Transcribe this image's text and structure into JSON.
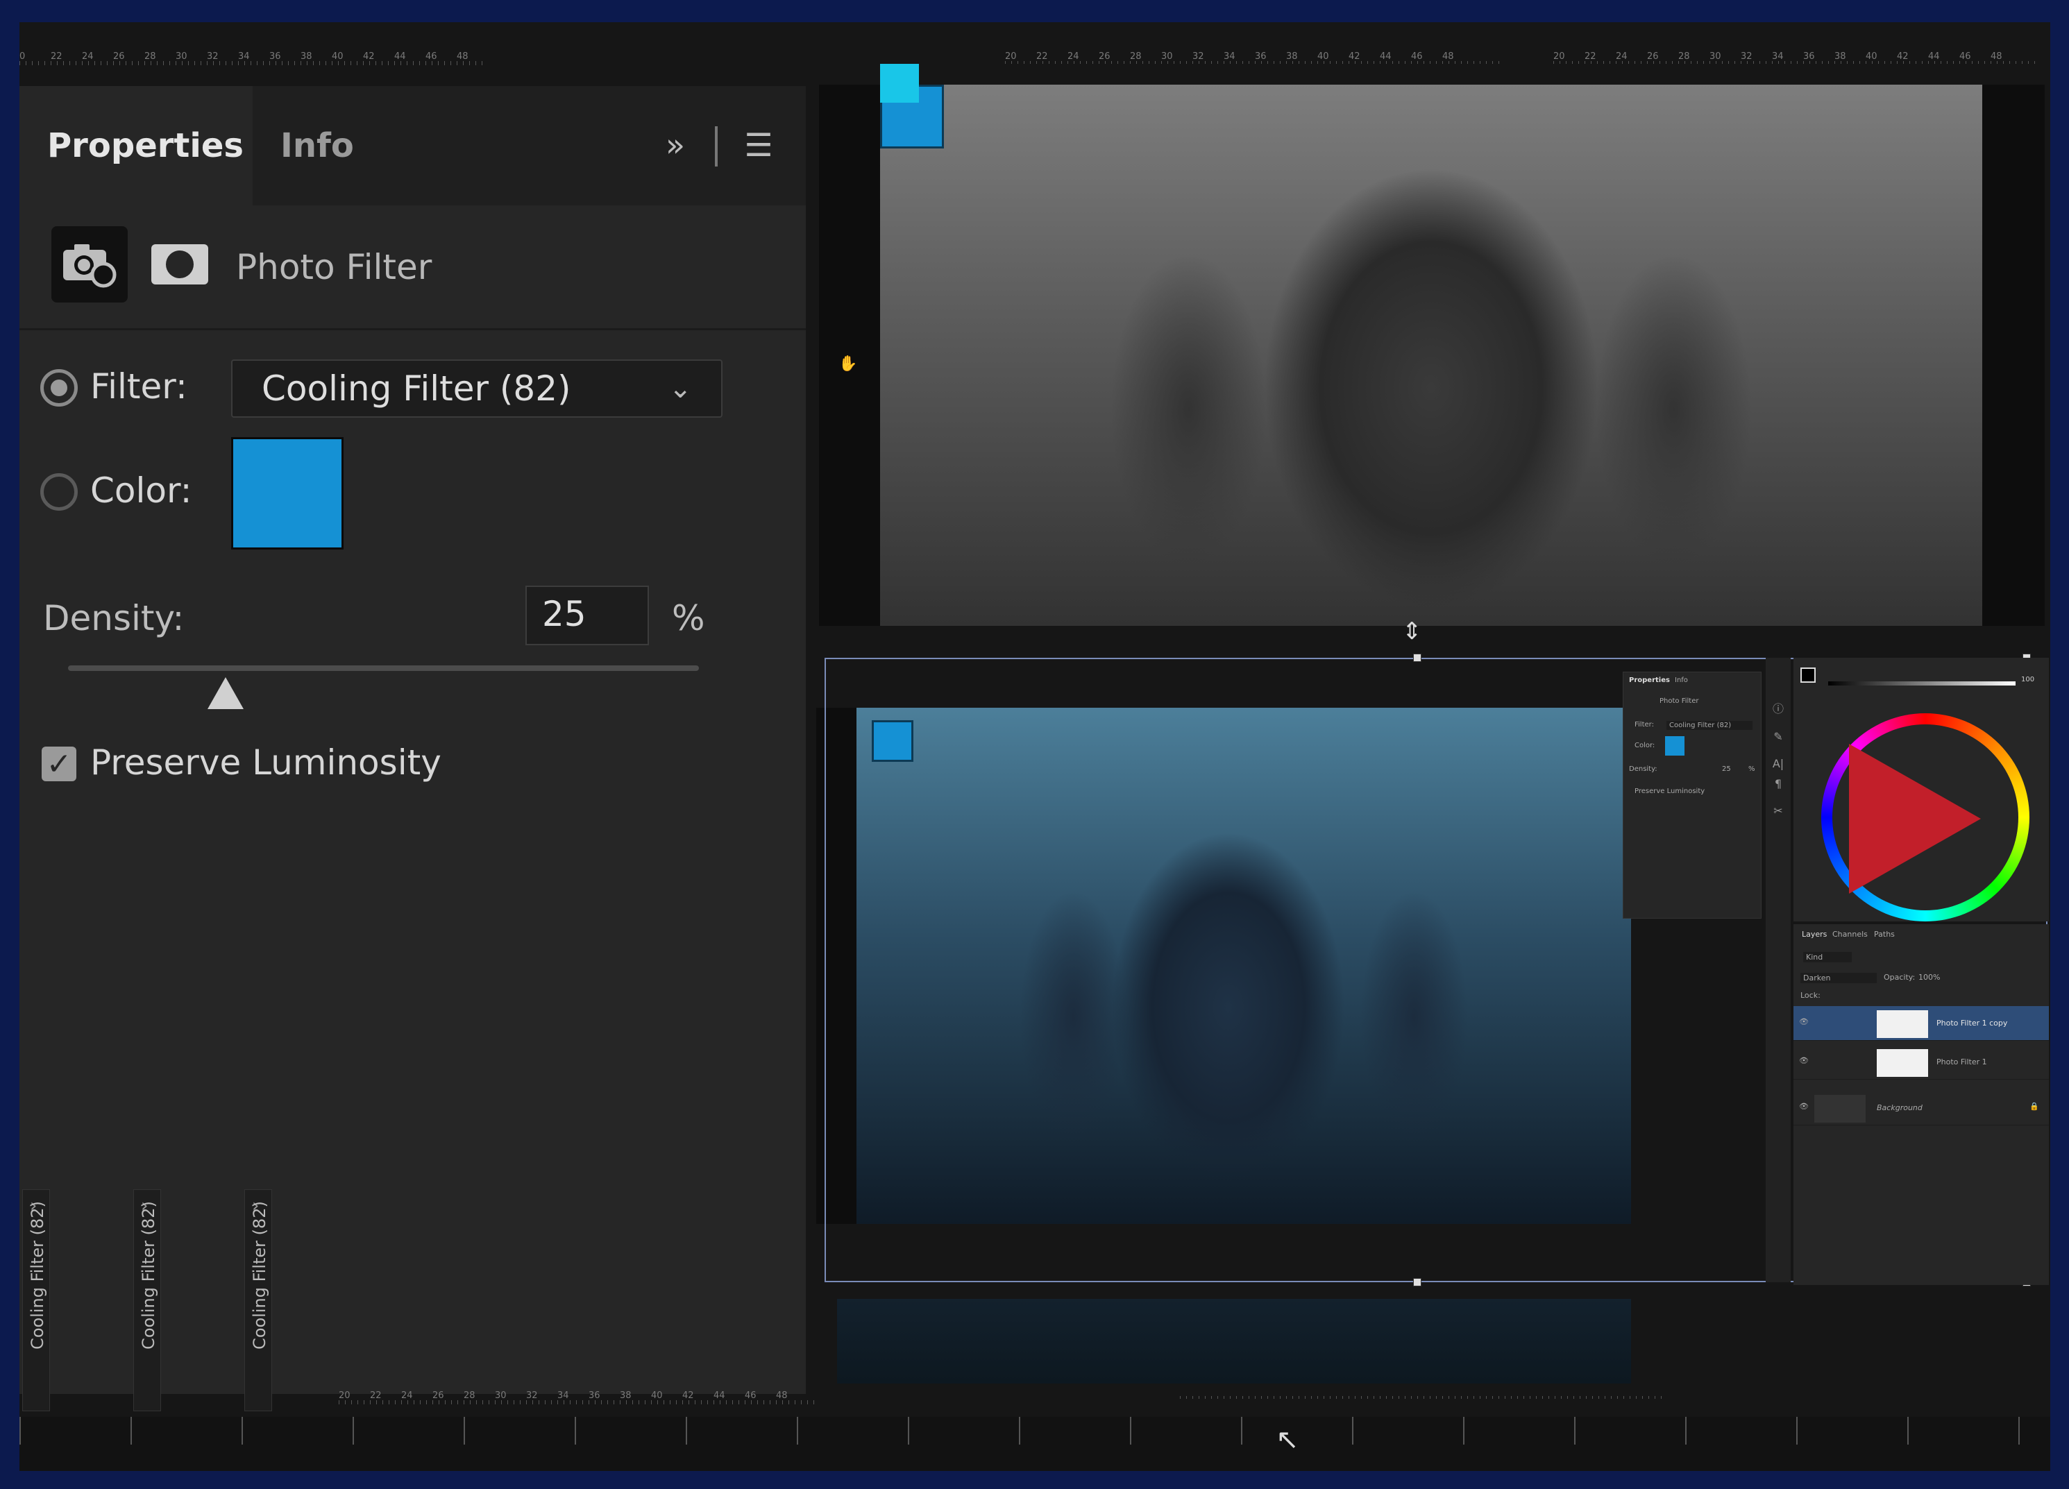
{
  "panel": {
    "tabs": [
      {
        "label": "Properties"
      },
      {
        "label": "Info"
      }
    ],
    "expand_icon": "chevrons-right-icon",
    "menu_icon": "hamburger-menu-icon",
    "title": "Photo Filter",
    "filter_label": "Filter:",
    "filter_value": "Cooling Filter (82)",
    "color_label": "Color:",
    "color_value": "#1591d4",
    "density_label": "Density:",
    "density_value": "25",
    "density_unit": "%",
    "density_fraction": 0.25,
    "preserve_label": "Preserve Luminosity",
    "preserve_checked": true
  },
  "thumbnails": [
    {
      "label": "Cooling Filter (82)"
    },
    {
      "label": "Cooling Filter (82)"
    },
    {
      "label": "Cooling Filter (82)"
    }
  ],
  "mini_properties": {
    "tab1": "Properties",
    "tab2": "Info",
    "title": "Photo Filter",
    "filter_label": "Filter:",
    "filter_value": "Cooling Filter (82)",
    "color_label": "Color:",
    "density_label": "Density:",
    "density_value": "25",
    "density_unit": "%",
    "preserve_label": "Preserve Luminosity"
  },
  "layers_panel": {
    "tabs": [
      "Layers",
      "Channels",
      "Paths"
    ],
    "kind": "Kind",
    "blend_mode": "Darken",
    "opacity_label": "Opacity:",
    "opacity_value": "100%",
    "lock_label": "Lock:",
    "layers": [
      {
        "name": "Photo Filter 1 copy",
        "selected": true
      },
      {
        "name": "Photo Filter 1",
        "selected": false
      },
      {
        "name": "Background",
        "selected": false
      }
    ]
  },
  "color_panel": {
    "value": "100"
  },
  "ruler_numbers": [
    "20",
    "22",
    "24",
    "26",
    "28",
    "30",
    "32",
    "34",
    "36",
    "38",
    "40",
    "42",
    "44",
    "46",
    "48"
  ],
  "ruler_top_left": [
    "0",
    "22",
    "24",
    "26",
    "28",
    "30",
    "32",
    "34",
    "36",
    "38",
    "40",
    "42",
    "44",
    "46",
    "48"
  ],
  "colors": {
    "accent_blue": "#1591d4",
    "panel_bg": "#262626",
    "frame_border": "#0c1a4e"
  }
}
